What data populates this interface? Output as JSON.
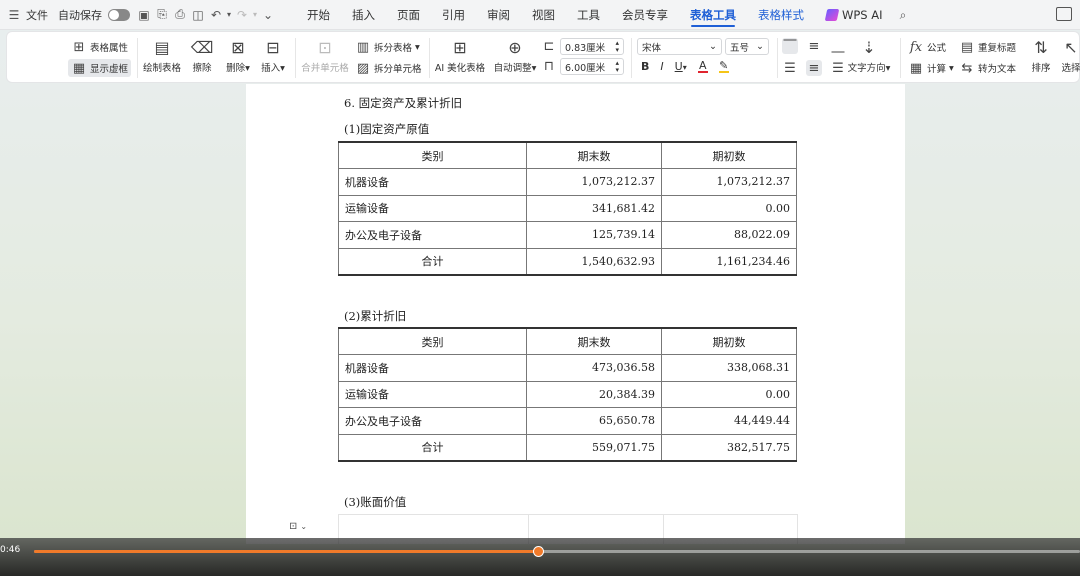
{
  "menubar": {
    "menu_icon": "hamburger-icon",
    "file_label": "文件",
    "autosave_label": "自动保存",
    "tabs": [
      {
        "label": "开始"
      },
      {
        "label": "插入"
      },
      {
        "label": "页面"
      },
      {
        "label": "引用"
      },
      {
        "label": "审阅"
      },
      {
        "label": "视图"
      },
      {
        "label": "工具"
      },
      {
        "label": "会员专享"
      },
      {
        "label": "表格工具"
      },
      {
        "label": "表格样式"
      },
      {
        "label": "WPS AI"
      }
    ],
    "active_tab": "表格工具"
  },
  "ribbon": {
    "table_props": "表格属性",
    "show_gridlines": "显示虚框",
    "draw_table": "绘制表格",
    "erase": "擦除",
    "delete": "删除",
    "insert": "插入",
    "merge_cells": "合并单元格",
    "split_table": "拆分表格",
    "split_cells": "拆分单元格",
    "ai_beautify": "AI 美化表格",
    "auto_adjust": "自动调整",
    "row_height": "0.83厘米",
    "col_width": "6.00厘米",
    "font_name": "宋体",
    "font_size": "五号",
    "bold": "B",
    "italic": "I",
    "underline": "U",
    "font_color": "A",
    "text_direction": "文字方向",
    "formula": "公式",
    "fx": "fx",
    "calculate": "计算",
    "repeat_header": "重复标题",
    "convert_text": "转为文本",
    "sort": "排序",
    "select": "选择",
    "colors": {
      "font_color_bar": "#e0242f",
      "highlight_bar": "#f5c518"
    }
  },
  "document": {
    "section_title": "6.  固定资产及累计折旧",
    "table1": {
      "caption": "(1)固定资产原值",
      "headers": [
        "类别",
        "期末数",
        "期初数"
      ],
      "rows": [
        [
          "机器设备",
          "1,073,212.37",
          "1,073,212.37"
        ],
        [
          "运输设备",
          "341,681.42",
          "0.00"
        ],
        [
          "办公及电子设备",
          "125,739.14",
          "88,022.09"
        ]
      ],
      "total": [
        "合计",
        "1,540,632.93",
        "1,161,234.46"
      ]
    },
    "table2": {
      "caption": "(2)累计折旧",
      "headers": [
        "类别",
        "期末数",
        "期初数"
      ],
      "rows": [
        [
          "机器设备",
          "473,036.58",
          "338,068.31"
        ],
        [
          "运输设备",
          "20,384.39",
          "0.00"
        ],
        [
          "办公及电子设备",
          "65,650.78",
          "44,449.44"
        ]
      ],
      "total": [
        "合计",
        "559,071.75",
        "382,517.75"
      ]
    },
    "table3": {
      "caption": "(3)账面价值"
    }
  },
  "video": {
    "time": "0:46",
    "progress": 0.482,
    "accent": "#f07a2a"
  }
}
